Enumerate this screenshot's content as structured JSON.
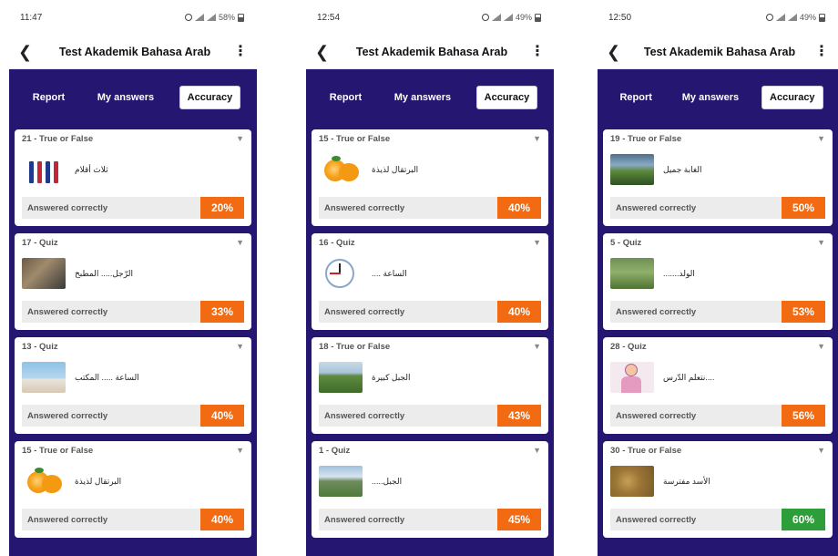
{
  "colors": {
    "purple": "#241671",
    "orange": "#f26a12",
    "green": "#2e9e3a"
  },
  "phones": [
    {
      "status": {
        "time": "11:47",
        "battery": "58%"
      },
      "header": {
        "title": "Test Akademik Bahasa Arab"
      },
      "tabs": [
        "Report",
        "My answers",
        "Accuracy"
      ],
      "cards": [
        {
          "label": "21 - True or False",
          "question": "ثلاث أقلام",
          "result": "Answered correctly",
          "percent": "20%"
        },
        {
          "label": "17 - Quiz",
          "question": "الرّجل..... المطبخ",
          "result": "Answered correctly",
          "percent": "33%"
        },
        {
          "label": "13 - Quiz",
          "question": "الساعة ..... المكتب",
          "result": "Answered correctly",
          "percent": "40%"
        },
        {
          "label": "15 - True or False",
          "question": "البرتقال لذيذة",
          "result": "Answered correctly",
          "percent": "40%"
        }
      ]
    },
    {
      "status": {
        "time": "12:54",
        "battery": "49%"
      },
      "header": {
        "title": "Test Akademik Bahasa Arab"
      },
      "tabs": [
        "Report",
        "My answers",
        "Accuracy"
      ],
      "cards": [
        {
          "label": "15 - True or False",
          "question": "البرتقال لذيذة",
          "result": "Answered correctly",
          "percent": "40%"
        },
        {
          "label": "16 - Quiz",
          "question": "الساعة ....",
          "result": "Answered correctly",
          "percent": "40%"
        },
        {
          "label": "18 - True or False",
          "question": "الجبل كبيرة",
          "result": "Answered correctly",
          "percent": "43%"
        },
        {
          "label": "1 - Quiz",
          "question": "الجبل.....",
          "result": "Answered correctly",
          "percent": "45%"
        }
      ]
    },
    {
      "status": {
        "time": "12:50",
        "battery": "49%"
      },
      "header": {
        "title": "Test Akademik Bahasa Arab"
      },
      "tabs": [
        "Report",
        "My answers",
        "Accuracy"
      ],
      "cards": [
        {
          "label": "19 - True or False",
          "question": "الغابة جميل",
          "result": "Answered correctly",
          "percent": "50%"
        },
        {
          "label": "5 - Quiz",
          "question": "الولد.......",
          "result": "Answered correctly",
          "percent": "53%"
        },
        {
          "label": "28 - Quiz",
          "question": "....نتعلم الدّرس",
          "result": "Answered correctly",
          "percent": "56%"
        },
        {
          "label": "30 - True or False",
          "question": "الأسد مفترسة",
          "result": "Answered correctly",
          "percent": "60%"
        }
      ]
    }
  ]
}
